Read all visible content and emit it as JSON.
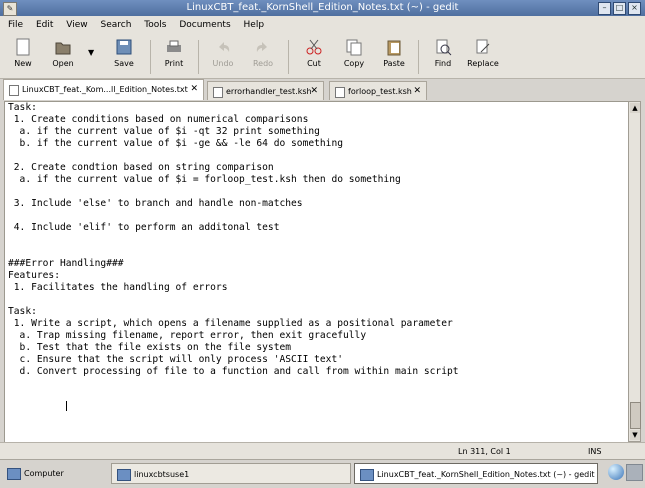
{
  "window": {
    "title": "LinuxCBT_feat._KornShell_Edition_Notes.txt (~) - gedit"
  },
  "menu": [
    "File",
    "Edit",
    "View",
    "Search",
    "Tools",
    "Documents",
    "Help"
  ],
  "toolbar": [
    {
      "label": "New",
      "icon": "new-file-icon"
    },
    {
      "label": "Open",
      "icon": "open-folder-icon"
    },
    {
      "label": "Save",
      "icon": "save-icon"
    },
    {
      "label": "Print",
      "icon": "print-icon"
    },
    {
      "label": "Undo",
      "icon": "undo-icon"
    },
    {
      "label": "Redo",
      "icon": "redo-icon"
    },
    {
      "label": "Cut",
      "icon": "cut-icon"
    },
    {
      "label": "Copy",
      "icon": "copy-icon"
    },
    {
      "label": "Paste",
      "icon": "paste-icon"
    },
    {
      "label": "Find",
      "icon": "find-icon"
    },
    {
      "label": "Replace",
      "icon": "replace-icon"
    }
  ],
  "tabs": [
    {
      "label": "LinuxCBT_feat._Kom...ll_Edition_Notes.txt"
    },
    {
      "label": "errorhandler_test.ksh"
    },
    {
      "label": "forloop_test.ksh"
    }
  ],
  "editor": {
    "content": "Task:\n 1. Create conditions based on numerical comparisons\n  a. if the current value of $i -qt 32 print something\n  b. if the current value of $i -ge && -le 64 do something\n\n 2. Create condtion based on string comparison\n  a. if the current value of $i = forloop_test.ksh then do something\n\n 3. Include 'else' to branch and handle non-matches\n\n 4. Include 'elif' to perform an additonal test\n\n\n###Error Handling###\nFeatures:\n 1. Facilitates the handling of errors\n\nTask:\n 1. Write a script, which opens a filename supplied as a positional parameter\n  a. Trap missing filename, report error, then exit gracefully\n  b. Test that the file exists on the file system\n  c. Ensure that the script will only process 'ASCII text'\n  d. Convert processing of file to a function and call from within main script"
  },
  "status": {
    "position": "Ln 311, Col 1",
    "mode": "INS"
  },
  "taskbar": {
    "computer": "Computer",
    "items": [
      {
        "label": "linuxcbtsuse1"
      },
      {
        "label": "LinuxCBT_feat._KornShell_Edition_Notes.txt (~) - gedit"
      }
    ]
  }
}
